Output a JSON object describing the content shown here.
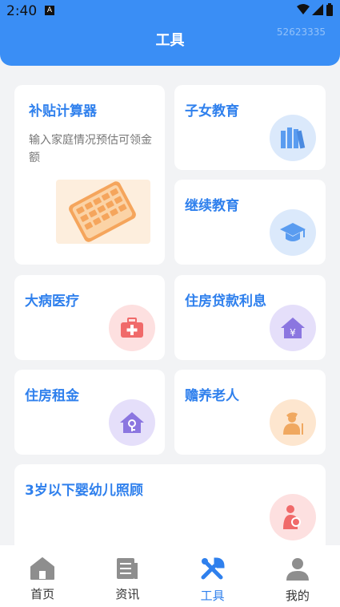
{
  "status": {
    "time": "2:40",
    "indicator": "A"
  },
  "header": {
    "title": "工具",
    "watermark": "52623335"
  },
  "cards": {
    "subsidy": {
      "title": "补贴计算器",
      "desc": "输入家庭情况预估可领金额",
      "icon": "calculator-icon"
    },
    "children_education": {
      "title": "子女教育",
      "icon": "books-icon",
      "color": "#5a9cf0"
    },
    "continuing_education": {
      "title": "继续教育",
      "icon": "graduation-cap-icon",
      "color": "#5a9cf0"
    },
    "medical": {
      "title": "大病医疗",
      "icon": "medical-kit-icon",
      "color": "#f06a6a"
    },
    "housing_loan": {
      "title": "住房贷款利息",
      "icon": "house-yen-icon",
      "color": "#8b76e0"
    },
    "housing_rent": {
      "title": "住房租金",
      "icon": "house-key-icon",
      "color": "#8b76e0"
    },
    "elderly": {
      "title": "赡养老人",
      "icon": "elderly-person-icon",
      "color": "#f0a860"
    },
    "infant": {
      "title": "3岁以下婴幼儿照顾",
      "icon": "mother-baby-icon",
      "color": "#f06a6a"
    }
  },
  "tabbar": {
    "home": "首页",
    "news": "资讯",
    "tools": "工具",
    "mine": "我的"
  },
  "colors": {
    "accent": "#2f80ed",
    "header": "#3a8ef5"
  }
}
